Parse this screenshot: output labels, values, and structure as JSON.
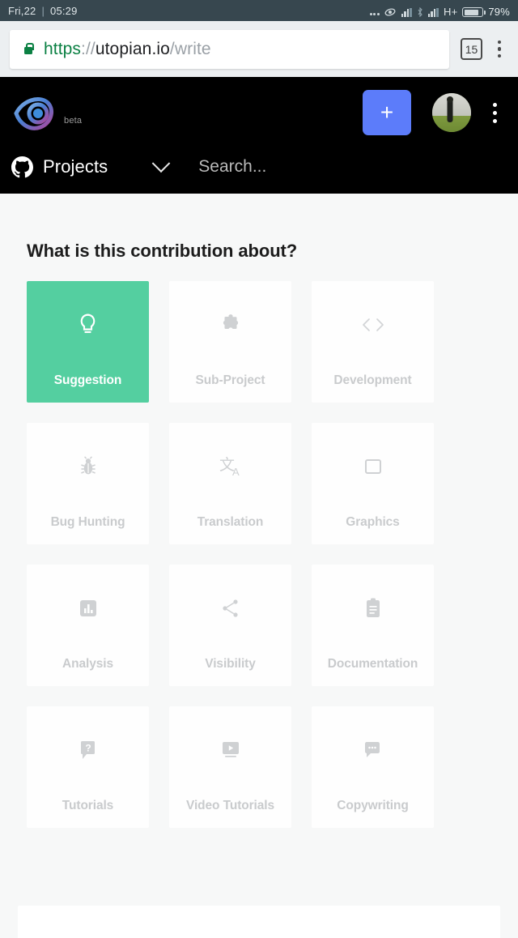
{
  "statusbar": {
    "date": "Fri,22",
    "separator": "|",
    "time": "05:29",
    "network_type": "H+",
    "battery_percent": "79%",
    "icons": [
      "more-dots-icon",
      "data-saver-icon",
      "signal-bars-icon",
      "bluetooth-icon",
      "signal-bars-icon",
      "battery-icon"
    ]
  },
  "browser": {
    "url": {
      "scheme": "https",
      "separator": "://",
      "host": "utopian.io",
      "path": "/write",
      "full": "https://utopian.io/write"
    },
    "lock_icon": "padlock-icon",
    "tab_count": "15",
    "menu_icon": "kebab-menu-icon"
  },
  "app_header": {
    "logo_name": "utopian-logo",
    "beta_label": "beta",
    "new_post_label": "+",
    "new_post_color": "#5c7cfa",
    "avatar_name": "user-avatar",
    "menu_icon": "kebab-menu-icon",
    "source_icon": "github-icon",
    "source_label": "Projects",
    "dropdown_icon": "chevron-down-icon",
    "search_placeholder": "Search..."
  },
  "main": {
    "heading": "What is this contribution about?",
    "selected_category": "Suggestion",
    "selected_color": "#54cfa0",
    "categories": [
      {
        "label": "Suggestion",
        "icon": "lightbulb-icon",
        "selected": true
      },
      {
        "label": "Sub-Project",
        "icon": "puzzle-piece-icon",
        "selected": false
      },
      {
        "label": "Development",
        "icon": "code-brackets-icon",
        "selected": false
      },
      {
        "label": "Bug Hunting",
        "icon": "bug-icon",
        "selected": false
      },
      {
        "label": "Translation",
        "icon": "translate-icon",
        "selected": false
      },
      {
        "label": "Graphics",
        "icon": "image-frame-icon",
        "selected": false
      },
      {
        "label": "Analysis",
        "icon": "bar-chart-icon",
        "selected": false
      },
      {
        "label": "Visibility",
        "icon": "share-icon",
        "selected": false
      },
      {
        "label": "Documentation",
        "icon": "clipboard-icon",
        "selected": false
      },
      {
        "label": "Tutorials",
        "icon": "question-bubble-icon",
        "selected": false
      },
      {
        "label": "Video Tutorials",
        "icon": "video-play-icon",
        "selected": false
      },
      {
        "label": "Copywriting",
        "icon": "chat-bubble-icon",
        "selected": false
      }
    ]
  }
}
